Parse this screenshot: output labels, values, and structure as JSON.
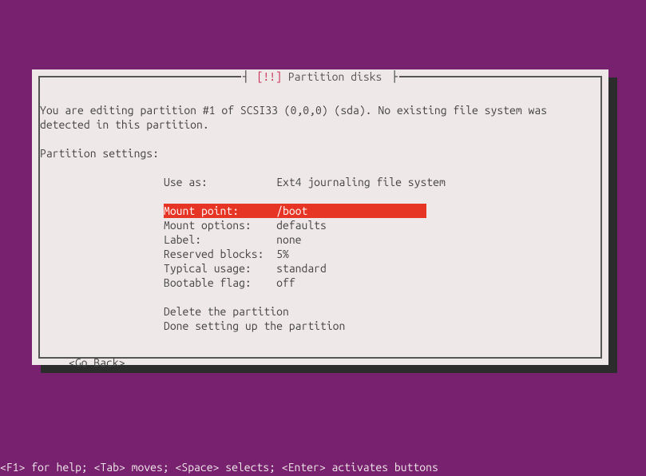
{
  "title": {
    "warning": "[!!]",
    "text": "Partition disks"
  },
  "intro": {
    "line1": "You are editing partition #1 of SCSI33 (0,0,0) (sda). No existing file system was",
    "line2": "detected in this partition."
  },
  "settings_heading": "Partition settings:",
  "settings": {
    "use_as": {
      "label": "Use as:         ",
      "value": "Ext4 journaling file system"
    },
    "mount_point": {
      "label": "Mount point:    ",
      "value": "/boot                   "
    },
    "mount_options": {
      "label": "Mount options:  ",
      "value": "defaults"
    },
    "label": {
      "label": "Label:          ",
      "value": "none"
    },
    "reserved": {
      "label": "Reserved blocks:",
      "value": "5%"
    },
    "typical": {
      "label": "Typical usage:  ",
      "value": "standard"
    },
    "bootable": {
      "label": "Bootable flag:  ",
      "value": "off"
    }
  },
  "actions": {
    "delete": "Delete the partition",
    "done": "Done setting up the partition"
  },
  "go_back": "<Go Back>",
  "help_bar": "<F1> for help; <Tab> moves; <Space> selects; <Enter> activates buttons"
}
